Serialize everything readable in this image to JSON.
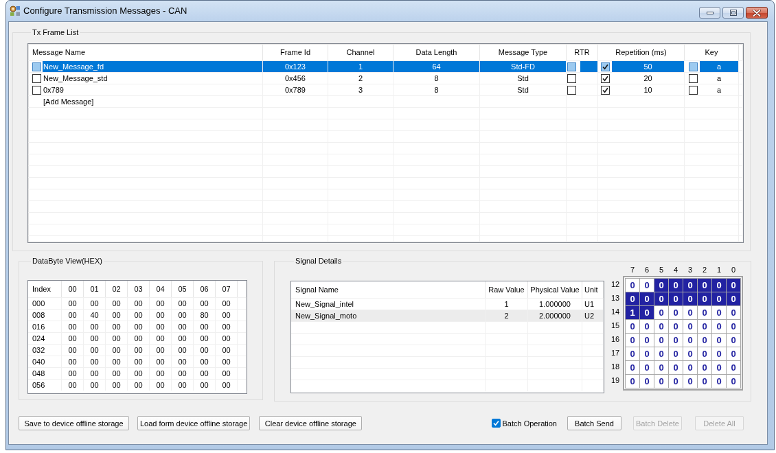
{
  "window": {
    "title": "Configure Transmission Messages - CAN"
  },
  "tx_frame_list": {
    "title": "Tx Frame List",
    "columns": [
      "Message Name",
      "Frame Id",
      "Channel",
      "Data Length",
      "Message Type",
      "RTR",
      "Repetition (ms)",
      "Key"
    ],
    "rows": [
      {
        "selected": true,
        "checked": false,
        "name": "New_Message_fd",
        "frame_id": "0x123",
        "channel": "1",
        "data_length": "64",
        "message_type": "Std-FD",
        "rtr": false,
        "repetition_enabled": true,
        "repetition": "50",
        "key_enabled": false,
        "key": "a"
      },
      {
        "selected": false,
        "checked": false,
        "name": "New_Message_std",
        "frame_id": "0x456",
        "channel": "2",
        "data_length": "8",
        "message_type": "Std",
        "rtr": false,
        "repetition_enabled": true,
        "repetition": "20",
        "key_enabled": false,
        "key": "a"
      },
      {
        "selected": false,
        "checked": false,
        "name": "0x789",
        "frame_id": "0x789",
        "channel": "3",
        "data_length": "8",
        "message_type": "Std",
        "rtr": false,
        "repetition_enabled": true,
        "repetition": "10",
        "key_enabled": false,
        "key": "a"
      }
    ],
    "add_row_label": "[Add Message]"
  },
  "databyte_view": {
    "title": "DataByte View(HEX)",
    "columns": [
      "Index",
      "00",
      "01",
      "02",
      "03",
      "04",
      "05",
      "06",
      "07"
    ],
    "rows": [
      {
        "index": "000",
        "bytes": [
          "00",
          "00",
          "00",
          "00",
          "00",
          "00",
          "00",
          "00"
        ]
      },
      {
        "index": "008",
        "bytes": [
          "00",
          "40",
          "00",
          "00",
          "00",
          "00",
          "80",
          "00"
        ]
      },
      {
        "index": "016",
        "bytes": [
          "00",
          "00",
          "00",
          "00",
          "00",
          "00",
          "00",
          "00"
        ]
      },
      {
        "index": "024",
        "bytes": [
          "00",
          "00",
          "00",
          "00",
          "00",
          "00",
          "00",
          "00"
        ]
      },
      {
        "index": "032",
        "bytes": [
          "00",
          "00",
          "00",
          "00",
          "00",
          "00",
          "00",
          "00"
        ]
      },
      {
        "index": "040",
        "bytes": [
          "00",
          "00",
          "00",
          "00",
          "00",
          "00",
          "00",
          "00"
        ]
      },
      {
        "index": "048",
        "bytes": [
          "00",
          "00",
          "00",
          "00",
          "00",
          "00",
          "00",
          "00"
        ]
      },
      {
        "index": "056",
        "bytes": [
          "00",
          "00",
          "00",
          "00",
          "00",
          "00",
          "00",
          "00"
        ]
      }
    ]
  },
  "signal_details": {
    "title": "Signal Details",
    "columns": [
      "Signal Name",
      "Raw Value",
      "Physical Value",
      "Unit"
    ],
    "rows": [
      {
        "selected": false,
        "name": "New_Signal_intel",
        "raw_value": "1",
        "physical_value": "1.000000",
        "unit": "U1"
      },
      {
        "selected": true,
        "name": "New_Signal_moto",
        "raw_value": "2",
        "physical_value": "2.000000",
        "unit": "U2"
      }
    ],
    "bit_grid": {
      "column_labels": [
        "7",
        "6",
        "5",
        "4",
        "3",
        "2",
        "1",
        "0"
      ],
      "rows": [
        {
          "label": "12",
          "bits": [
            {
              "value": "0",
              "highlighted": false
            },
            {
              "value": "0",
              "highlighted": false
            },
            {
              "value": "0",
              "highlighted": true
            },
            {
              "value": "0",
              "highlighted": true
            },
            {
              "value": "0",
              "highlighted": true
            },
            {
              "value": "0",
              "highlighted": true
            },
            {
              "value": "0",
              "highlighted": true
            },
            {
              "value": "0",
              "highlighted": true
            }
          ]
        },
        {
          "label": "13",
          "bits": [
            {
              "value": "0",
              "highlighted": true
            },
            {
              "value": "0",
              "highlighted": true
            },
            {
              "value": "0",
              "highlighted": true
            },
            {
              "value": "0",
              "highlighted": true
            },
            {
              "value": "0",
              "highlighted": true
            },
            {
              "value": "0",
              "highlighted": true
            },
            {
              "value": "0",
              "highlighted": true
            },
            {
              "value": "0",
              "highlighted": true
            }
          ]
        },
        {
          "label": "14",
          "bits": [
            {
              "value": "1",
              "highlighted": true
            },
            {
              "value": "0",
              "highlighted": true
            },
            {
              "value": "0",
              "highlighted": false
            },
            {
              "value": "0",
              "highlighted": false
            },
            {
              "value": "0",
              "highlighted": false
            },
            {
              "value": "0",
              "highlighted": false
            },
            {
              "value": "0",
              "highlighted": false
            },
            {
              "value": "0",
              "highlighted": false
            }
          ]
        },
        {
          "label": "15",
          "bits": [
            {
              "value": "0",
              "highlighted": false
            },
            {
              "value": "0",
              "highlighted": false
            },
            {
              "value": "0",
              "highlighted": false
            },
            {
              "value": "0",
              "highlighted": false
            },
            {
              "value": "0",
              "highlighted": false
            },
            {
              "value": "0",
              "highlighted": false
            },
            {
              "value": "0",
              "highlighted": false
            },
            {
              "value": "0",
              "highlighted": false
            }
          ]
        },
        {
          "label": "16",
          "bits": [
            {
              "value": "0",
              "highlighted": false
            },
            {
              "value": "0",
              "highlighted": false
            },
            {
              "value": "0",
              "highlighted": false
            },
            {
              "value": "0",
              "highlighted": false
            },
            {
              "value": "0",
              "highlighted": false
            },
            {
              "value": "0",
              "highlighted": false
            },
            {
              "value": "0",
              "highlighted": false
            },
            {
              "value": "0",
              "highlighted": false
            }
          ]
        },
        {
          "label": "17",
          "bits": [
            {
              "value": "0",
              "highlighted": false
            },
            {
              "value": "0",
              "highlighted": false
            },
            {
              "value": "0",
              "highlighted": false
            },
            {
              "value": "0",
              "highlighted": false
            },
            {
              "value": "0",
              "highlighted": false
            },
            {
              "value": "0",
              "highlighted": false
            },
            {
              "value": "0",
              "highlighted": false
            },
            {
              "value": "0",
              "highlighted": false
            }
          ]
        },
        {
          "label": "18",
          "bits": [
            {
              "value": "0",
              "highlighted": false
            },
            {
              "value": "0",
              "highlighted": false
            },
            {
              "value": "0",
              "highlighted": false
            },
            {
              "value": "0",
              "highlighted": false
            },
            {
              "value": "0",
              "highlighted": false
            },
            {
              "value": "0",
              "highlighted": false
            },
            {
              "value": "0",
              "highlighted": false
            },
            {
              "value": "0",
              "highlighted": false
            }
          ]
        },
        {
          "label": "19",
          "bits": [
            {
              "value": "0",
              "highlighted": false
            },
            {
              "value": "0",
              "highlighted": false
            },
            {
              "value": "0",
              "highlighted": false
            },
            {
              "value": "0",
              "highlighted": false
            },
            {
              "value": "0",
              "highlighted": false
            },
            {
              "value": "0",
              "highlighted": false
            },
            {
              "value": "0",
              "highlighted": false
            },
            {
              "value": "0",
              "highlighted": false
            }
          ]
        }
      ]
    }
  },
  "footer": {
    "left_buttons": [
      {
        "label": "Save to device offline storage",
        "disabled": false
      },
      {
        "label": "Load form device offline storage",
        "disabled": false
      },
      {
        "label": "Clear device offline storage",
        "disabled": false
      }
    ],
    "batch_operation": {
      "label": "Batch Operation",
      "checked": true
    },
    "right_buttons": [
      {
        "label": "Batch Send",
        "disabled": false
      },
      {
        "label": "Batch Delete",
        "disabled": true
      },
      {
        "label": "Delete All",
        "disabled": true
      }
    ]
  }
}
